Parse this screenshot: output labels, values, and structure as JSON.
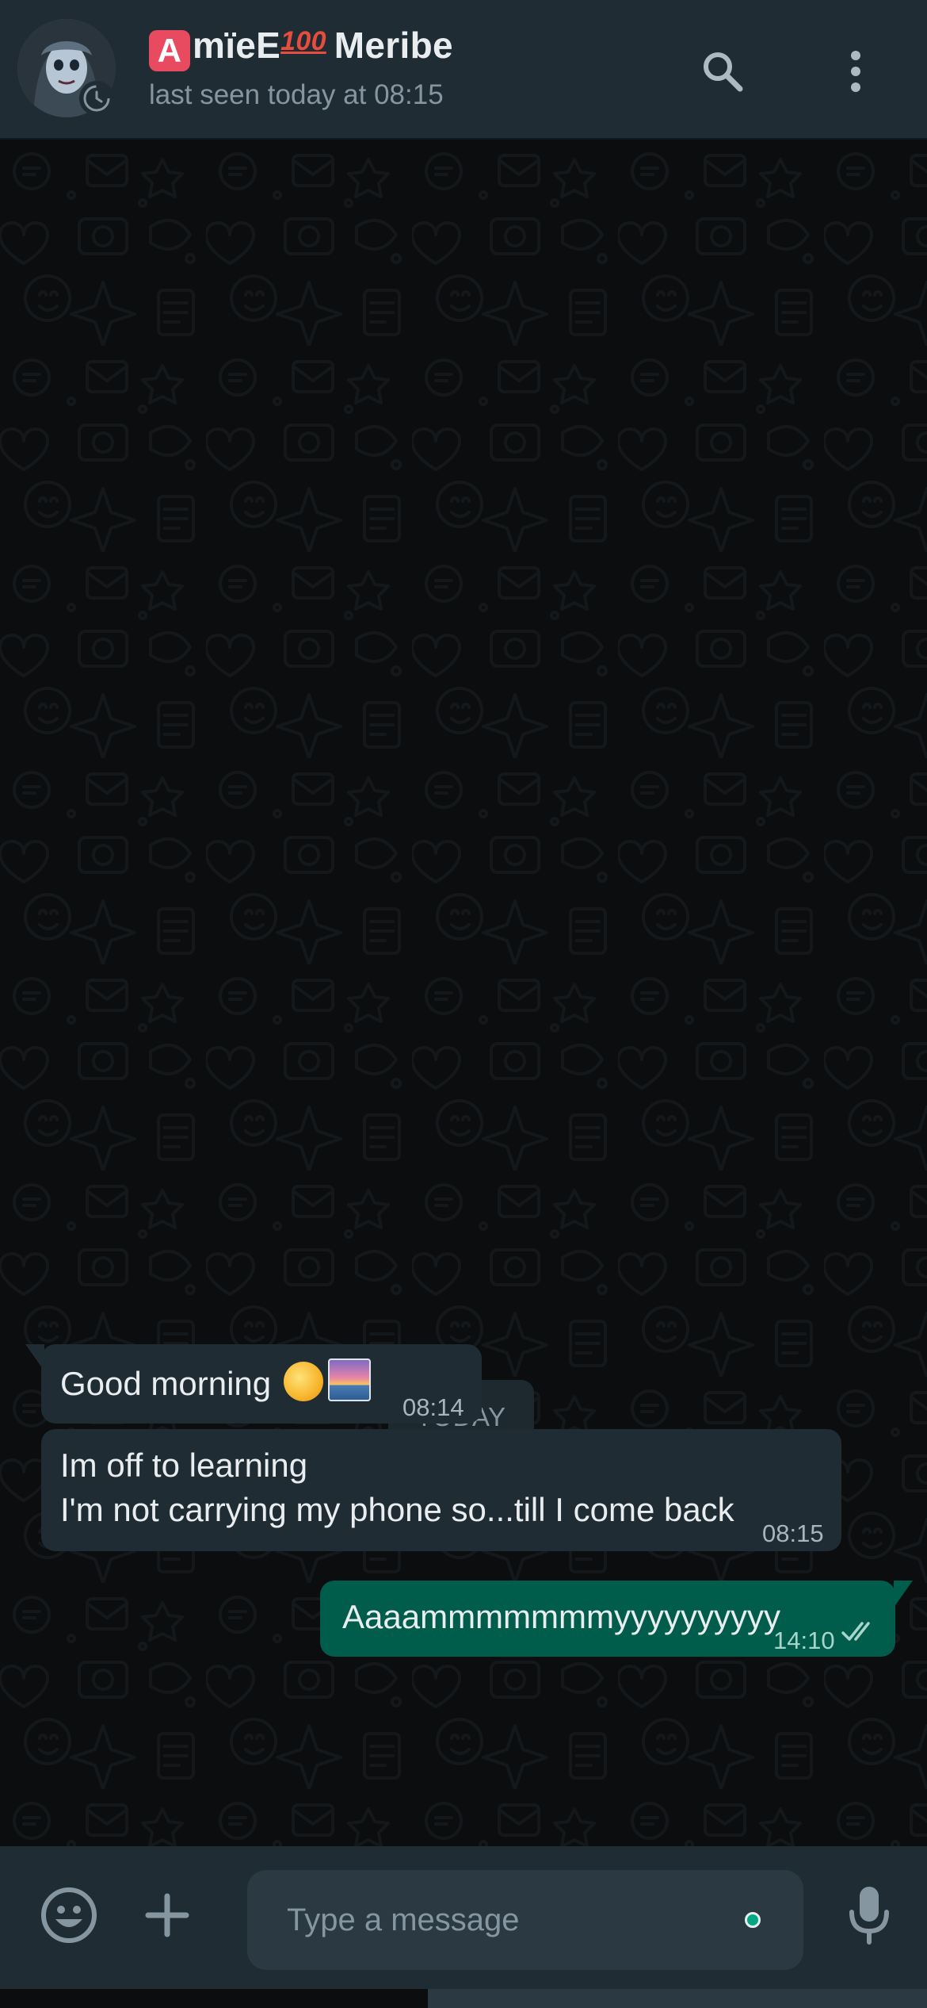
{
  "header": {
    "contact_name_badge": "A",
    "contact_name_part1": "mïeE",
    "contact_name_badge2": "100",
    "contact_name_part2": "Meribe",
    "last_seen": "last seen today at 08:15",
    "icons": [
      "avatar",
      "status-timer-icon",
      "search-icon",
      "more-vert-icon"
    ]
  },
  "chat": {
    "date_divider": "TODAY",
    "messages": [
      {
        "direction": "incoming",
        "lines": [
          "Good morning"
        ],
        "emojis": [
          "sun-face-emoji",
          "sunrise-emoji"
        ],
        "time": "08:14"
      },
      {
        "direction": "incoming",
        "lines": [
          "Im off to learning",
          "I'm not carrying my phone so...till I come back"
        ],
        "time": "08:15"
      },
      {
        "direction": "outgoing",
        "lines": [
          "Aaaammmmmmmyyyyyyyyyy"
        ],
        "time": "14:10",
        "status": "read-double-check-icon"
      }
    ]
  },
  "input_bar": {
    "placeholder": "Type a message",
    "icons": [
      "emoji-icon",
      "attach-plus-icon",
      "mic-icon"
    ]
  },
  "colors": {
    "header_bg": "#1f2c34",
    "chat_bg": "#0b0d0e",
    "incoming_bubble": "#1f2c34",
    "outgoing_bubble": "#005c4b",
    "accent": "#00a884",
    "read_tick": "#53bdeb"
  }
}
